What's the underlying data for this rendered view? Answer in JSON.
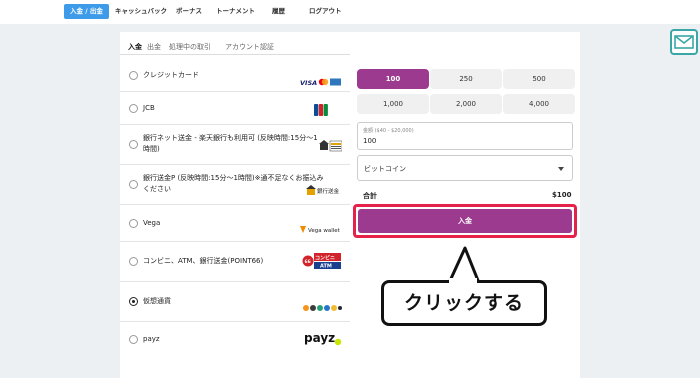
{
  "nav": {
    "items": [
      "入金 / 出金",
      "キャッシュバック",
      "ボーナス",
      "トーナメント",
      "履歴",
      "ログアウト"
    ]
  },
  "tabs": [
    "入金",
    "出金",
    "処理中の取引",
    "アカウント認証"
  ],
  "methods": [
    {
      "label": "クレジットカード",
      "logo": "card-brands-logo",
      "selected": false
    },
    {
      "label": "JCB",
      "logo": "jcb-logo",
      "selected": false
    },
    {
      "label": "銀行ネット送金 - 楽天銀行も利用可 (反映時間:15分〜1時間)",
      "logo": "bank-transfer-logo",
      "selected": false
    },
    {
      "label": "銀行送金P (反映時間:15分〜1時間)※通不足なくお振込みください",
      "logo": "bank-transfer-p-logo",
      "selected": false
    },
    {
      "label": "Vega",
      "logo": "vega-wallet-logo",
      "selected": false
    },
    {
      "label": "コンビニ、ATM、銀行送金(POINT66)",
      "logo": "point66-logo",
      "selected": false
    },
    {
      "label": "仮想通貨",
      "logo": "crypto-logo",
      "selected": true
    },
    {
      "label": "payz",
      "logo": "payz-logo",
      "selected": false
    }
  ],
  "logos": {
    "bank_transfer": "銀行送金",
    "vega": "Vega wallet",
    "point66_line1": "コンビニ",
    "point66_line2": "ATM",
    "payz": "payz"
  },
  "amounts": {
    "options": [
      "100",
      "250",
      "500",
      "1,000",
      "2,000",
      "4,000"
    ],
    "selected_index": 0
  },
  "amount_field": {
    "label": "金額 ($40 - $20,000)",
    "value": "100"
  },
  "currency": {
    "value": "ビットコイン"
  },
  "total": {
    "label": "合計",
    "value": "$100"
  },
  "deposit_button": "入金",
  "callout": "クリックする",
  "colors": {
    "accent": "#9b3a8f",
    "highlight": "#e5234a",
    "nav_active": "#3d9be9",
    "mail": "#3aa6a6"
  }
}
